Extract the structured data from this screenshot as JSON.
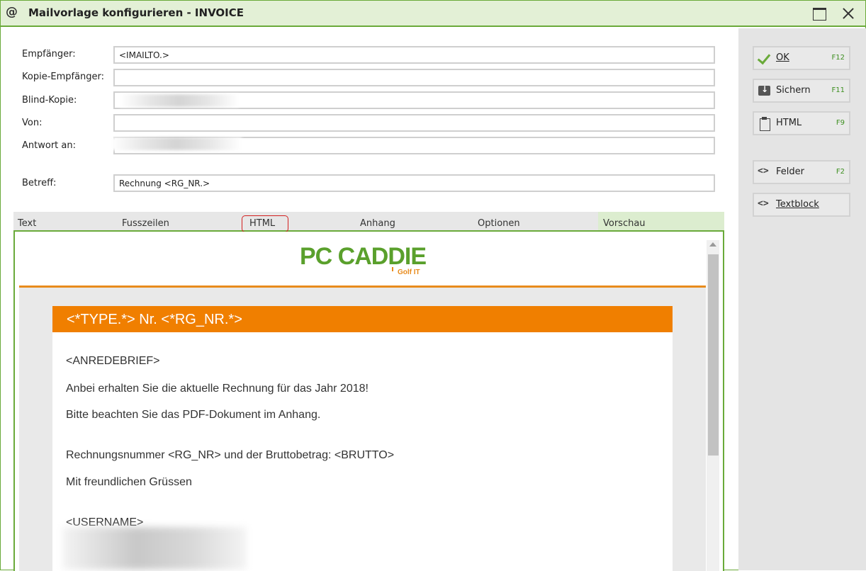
{
  "window": {
    "title": "Mailvorlage konfigurieren - INVOICE",
    "icon": "at-icon"
  },
  "form": {
    "fields": [
      {
        "label": "Empfänger:",
        "value": "<IMAILTO.>"
      },
      {
        "label": "Kopie-Empfänger:",
        "value": ""
      },
      {
        "label": "Blind-Kopie:",
        "value": ""
      },
      {
        "label": "Von:",
        "value": ""
      },
      {
        "label": "Antwort an:",
        "value": ""
      }
    ],
    "subject": {
      "label": "Betreff:",
      "value": "Rechnung <RG_NR.>"
    }
  },
  "tabs": [
    "Text",
    "Fusszeilen",
    "HTML",
    "Anhang",
    "Optionen",
    "Vorschau"
  ],
  "active_tab": "Vorschau",
  "highlighted_tab": "HTML",
  "sidebar": {
    "buttons": [
      {
        "label": "OK",
        "key": "F12",
        "icon": "check-icon"
      },
      {
        "label": "Sichern",
        "key": "F11",
        "icon": "save-icon"
      },
      {
        "label": "HTML",
        "key": "F9",
        "icon": "clipboard-icon"
      },
      {
        "label": "Felder",
        "key": "F2",
        "icon": "code-icon"
      },
      {
        "label": "Textblock",
        "key": "",
        "icon": "code-icon"
      }
    ]
  },
  "preview": {
    "logo": {
      "main": "PC CADDIE",
      "sub": "Golf IT"
    },
    "header": "<*TYPE.*> Nr. <*RG_NR.*>",
    "lines": [
      "<ANREDEBRIEF>",
      "Anbei erhalten Sie die aktuelle Rechnung für das Jahr 2018!",
      "Bitte beachten Sie das PDF-Dokument im Anhang.",
      "Rechnungsnummer <RG_NR> und der Bruttobetrag: <BRUTTO>",
      "Mit freundlichen Grüssen",
      "<USERNAME>"
    ]
  },
  "colors": {
    "accent_green": "#6aaa3a",
    "orange": "#f07f00",
    "highlight_red": "#d32020"
  }
}
